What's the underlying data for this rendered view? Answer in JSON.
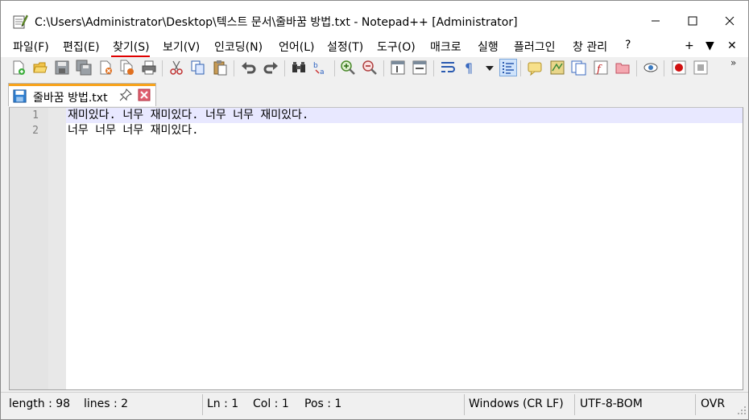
{
  "window": {
    "title": "C:\\Users\\Administrator\\Desktop\\텍스트 문서\\줄바꿈 방법.txt - Notepad++ [Administrator]",
    "minimize_icon": "minimize-icon",
    "maximize_icon": "maximize-icon",
    "close_icon": "close-icon"
  },
  "menu": {
    "items": [
      "파일(F)",
      "편집(E)",
      "찾기(S)",
      "보기(V)",
      "인코딩(N)",
      "언어(L)",
      "설정(T)",
      "도구(O)",
      "매크로",
      "실행",
      "플러그인",
      "창 관리",
      "?"
    ],
    "active_index": 2,
    "active_color": "#e00000",
    "right": {
      "plus": "+",
      "down": "▼",
      "close": "✕"
    }
  },
  "toolbar": {
    "icons": [
      "new-file-icon",
      "open-file-icon",
      "save-icon",
      "save-all-icon",
      "close-icon",
      "close-all-icon",
      "print-icon",
      "cut-icon",
      "copy-icon",
      "paste-icon",
      "undo-icon",
      "redo-icon",
      "find-icon",
      "replace-icon",
      "zoom-in-icon",
      "zoom-out-icon",
      "sync-vertical-icon",
      "sync-horizontal-icon",
      "word-wrap-icon",
      "show-all-characters-icon",
      "dropdown-icon",
      "indent-guide-icon",
      "user-defined-language-icon",
      "document-map-icon",
      "document-list-icon",
      "function-list-icon",
      "folder-as-workspace-icon",
      "monitoring-icon",
      "record-macro-icon",
      "stop-macro-icon"
    ],
    "more": "»"
  },
  "tab": {
    "label": "줄바꿈 방법.txt",
    "accent_color": "#f8a31b"
  },
  "editor": {
    "lines": [
      {
        "number": "1",
        "text": "재미있다. 너무 재미있다. 너무 너무 재미있다."
      },
      {
        "number": "2",
        "text": "너무 너무 너무 재미있다."
      }
    ],
    "current_line_color": "#e8e8ff"
  },
  "status": {
    "length": "length : 98",
    "lines": "lines : 2",
    "ln": "Ln : 1",
    "col": "Col : 1",
    "pos": "Pos : 1",
    "eol": "Windows (CR LF)",
    "encoding": "UTF-8-BOM",
    "mode": "OVR"
  }
}
